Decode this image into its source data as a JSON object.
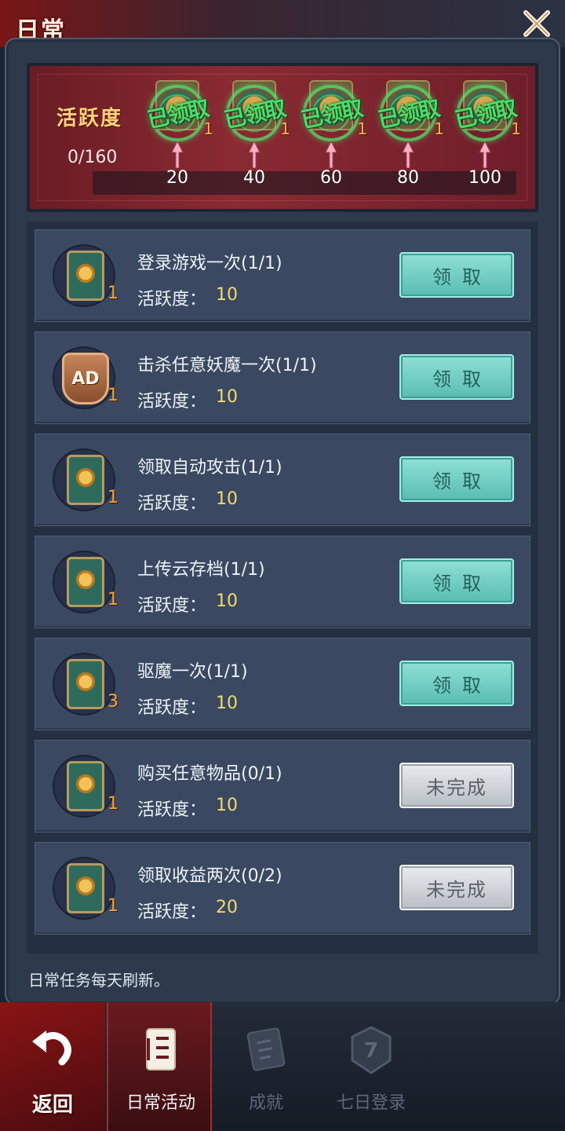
{
  "header": {
    "title": "日常"
  },
  "activity": {
    "label": "活跃度",
    "value_text": "0/160",
    "milestones": [
      {
        "value": "20",
        "claimed_text": "已领取",
        "reward_count": "1"
      },
      {
        "value": "40",
        "claimed_text": "已领取",
        "reward_count": "1"
      },
      {
        "value": "60",
        "claimed_text": "已领取",
        "reward_count": "1"
      },
      {
        "value": "80",
        "claimed_text": "已领取",
        "reward_count": "1"
      },
      {
        "value": "100",
        "claimed_text": "已领取",
        "reward_count": "1"
      }
    ]
  },
  "tasks": [
    {
      "name": "登录游戏一次(1/1)",
      "points_label": "活跃度：",
      "points": "10",
      "icon": "scroll-coin-icon",
      "count": "1",
      "button": "领取",
      "state": "claim"
    },
    {
      "name": "击杀任意妖魔一次(1/1)",
      "points_label": "活跃度：",
      "points": "10",
      "icon": "ad-icon",
      "icon_text": "AD",
      "count": "1",
      "button": "领取",
      "state": "claim"
    },
    {
      "name": "领取自动攻击(1/1)",
      "points_label": "活跃度：",
      "points": "10",
      "icon": "scroll-coin-icon",
      "count": "1",
      "button": "领取",
      "state": "claim"
    },
    {
      "name": "上传云存档(1/1)",
      "points_label": "活跃度：",
      "points": "10",
      "icon": "scroll-coin-icon",
      "count": "1",
      "button": "领取",
      "state": "claim"
    },
    {
      "name": "驱魔一次(1/1)",
      "points_label": "活跃度：",
      "points": "10",
      "icon": "scroll-coin-icon",
      "count": "3",
      "button": "领取",
      "state": "claim"
    },
    {
      "name": "购买任意物品(0/1)",
      "points_label": "活跃度：",
      "points": "10",
      "icon": "scroll-coin-icon",
      "count": "1",
      "button": "未完成",
      "state": "incomplete"
    },
    {
      "name": "领取收益两次(0/2)",
      "points_label": "活跃度：",
      "points": "20",
      "icon": "scroll-coin-icon",
      "count": "1",
      "button": "未完成",
      "state": "incomplete"
    }
  ],
  "footer_note": "日常任务每天刷新。",
  "nav": {
    "back": "返回",
    "tabs": [
      {
        "label": "日常活动",
        "icon": "scroll-list-icon",
        "active": true
      },
      {
        "label": "成就",
        "icon": "scroll-paper-icon",
        "active": false
      },
      {
        "label": "七日登录",
        "icon": "seven-badge-icon",
        "active": false
      }
    ]
  },
  "colors": {
    "claim_button": "#58bdb1",
    "incomplete_button": "#b9bec4",
    "points_value": "#f4d96a",
    "count_badge": "#f4a23c",
    "claimed_stamp": "#4bdd6a"
  }
}
